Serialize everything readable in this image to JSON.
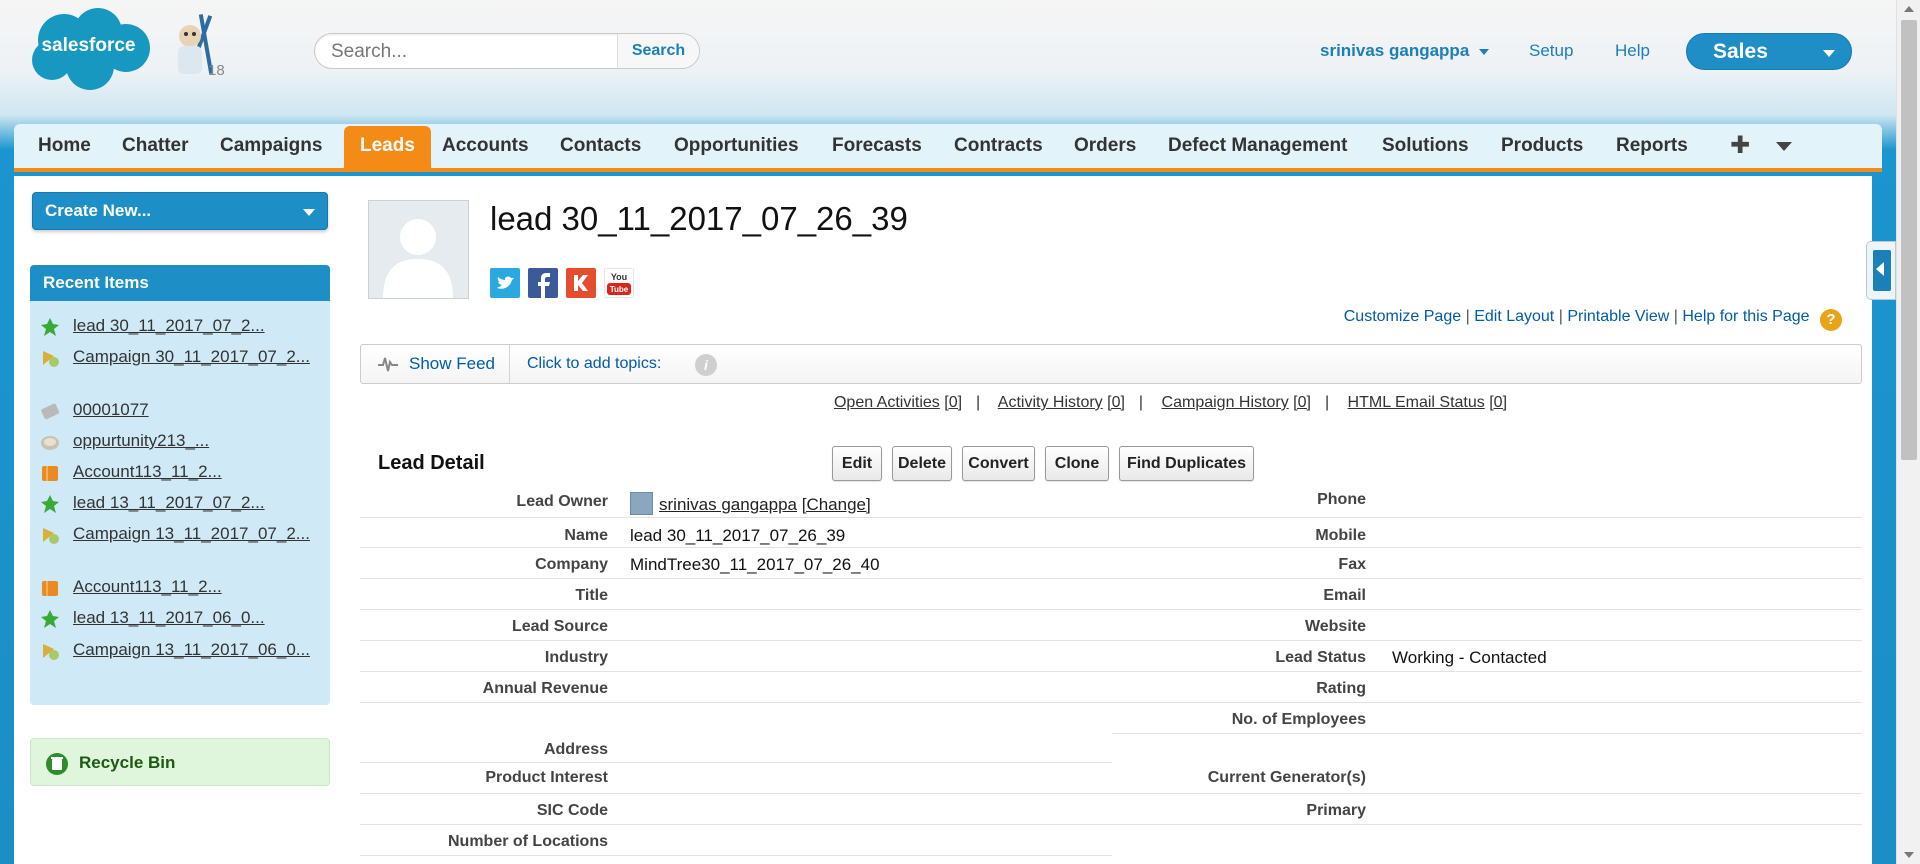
{
  "header": {
    "logo_text": "salesforce",
    "mascot_badge": "18",
    "search": {
      "placeholder": "Search...",
      "button_label": "Search"
    },
    "user_name": "srinivas gangappa",
    "links": [
      "Setup",
      "Help"
    ],
    "app_name": "Sales"
  },
  "tabs": [
    {
      "label": "Home"
    },
    {
      "label": "Chatter"
    },
    {
      "label": "Campaigns"
    },
    {
      "label": "Leads",
      "active": true
    },
    {
      "label": "Accounts"
    },
    {
      "label": "Contacts"
    },
    {
      "label": "Opportunities"
    },
    {
      "label": "Forecasts"
    },
    {
      "label": "Contracts"
    },
    {
      "label": "Orders"
    },
    {
      "label": "Defect Management"
    },
    {
      "label": "Solutions"
    },
    {
      "label": "Products"
    },
    {
      "label": "Reports"
    }
  ],
  "tabs_more": "✚",
  "sidebar": {
    "create_new": "Create New...",
    "recent_title": "Recent Items",
    "recent_items": [
      {
        "label": "lead 30_11_2017_07_2...",
        "icon": "lead-icon"
      },
      {
        "label": "Campaign 30_11_2017_07_2...",
        "icon": "campaign-icon"
      },
      {
        "label": "00001077",
        "icon": "case-icon"
      },
      {
        "label": "oppurtunity213_...",
        "icon": "opportunity-icon"
      },
      {
        "label": "Account113_11_2...",
        "icon": "account-icon"
      },
      {
        "label": "lead 13_11_2017_07_2...",
        "icon": "lead-icon"
      },
      {
        "label": "Campaign 13_11_2017_07_2...",
        "icon": "campaign-icon"
      },
      {
        "label": "Account113_11_2...",
        "icon": "account-icon"
      },
      {
        "label": "lead 13_11_2017_06_0...",
        "icon": "lead-icon"
      },
      {
        "label": "Campaign 13_11_2017_06_0...",
        "icon": "campaign-icon"
      }
    ],
    "recycle_bin": "Recycle Bin"
  },
  "record": {
    "title": "lead 30_11_2017_07_26_39",
    "page_links": [
      "Customize Page",
      "Edit Layout",
      "Printable View",
      "Help for this Page"
    ],
    "help_icon": "?",
    "feed": {
      "show_feed": "Show Feed",
      "topics": "Click to add topics:",
      "info_icon": "i"
    },
    "related": [
      {
        "label": "Open Activities",
        "count": "[0]"
      },
      {
        "label": "Activity History",
        "count": "[0]"
      },
      {
        "label": "Campaign History",
        "count": "[0]"
      },
      {
        "label": "HTML Email Status",
        "count": "[0]"
      }
    ],
    "related_separator": "|",
    "section_title": "Lead Detail",
    "buttons": [
      "Edit",
      "Delete",
      "Convert",
      "Clone",
      "Find Duplicates"
    ]
  },
  "detail": {
    "left": [
      {
        "label": "Lead Owner",
        "value": "srinivas gangappa",
        "extra": "[Change]"
      },
      {
        "label": "Name",
        "value": "lead 30_11_2017_07_26_39"
      },
      {
        "label": "Company",
        "value": "MindTree30_11_2017_07_26_40"
      },
      {
        "label": "Title",
        "value": ""
      },
      {
        "label": "Lead Source",
        "value": ""
      },
      {
        "label": "Industry",
        "value": ""
      },
      {
        "label": "Annual Revenue",
        "value": ""
      },
      {
        "label": "Address",
        "value": ""
      },
      {
        "label": "Product Interest",
        "value": ""
      },
      {
        "label": "SIC Code",
        "value": ""
      },
      {
        "label": "Number of Locations",
        "value": ""
      }
    ],
    "right": [
      {
        "label": "Phone",
        "value": ""
      },
      {
        "label": "Mobile",
        "value": ""
      },
      {
        "label": "Fax",
        "value": ""
      },
      {
        "label": "Email",
        "value": ""
      },
      {
        "label": "Website",
        "value": ""
      },
      {
        "label": "Lead Status",
        "value": "Working - Contacted"
      },
      {
        "label": "Rating",
        "value": ""
      },
      {
        "label": "No. of Employees",
        "value": ""
      },
      {
        "label": "Current Generator(s)",
        "value": ""
      },
      {
        "label": "Primary",
        "value": ""
      }
    ]
  },
  "colors": {
    "brand_blue": "#1e8fc6",
    "active_tab": "#f38b16",
    "link": "#015ba7"
  }
}
